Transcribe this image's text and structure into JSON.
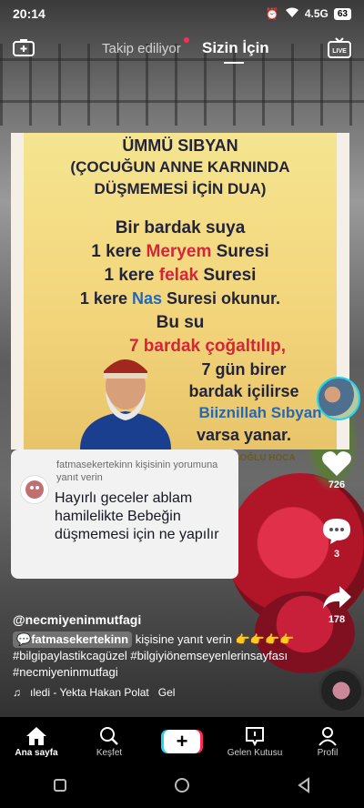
{
  "status_bar": {
    "time": "20:14",
    "network": "4.5G",
    "battery": "63"
  },
  "top_nav": {
    "following_label": "Takip ediliyor",
    "for_you_label": "Sizin İçin",
    "live_label": "LIVE"
  },
  "poster": {
    "title_line1": "ÜMMÜ SIBYAN",
    "title_line2": "(ÇOCUĞUN ANNE KARNINDA",
    "title_line3": "DÜŞMEMESİ İÇİN DUA)",
    "l1": "Bir bardak suya",
    "l2a": "1 kere ",
    "l2b": "Meryem",
    "l2c": " Suresi",
    "l3a": "1 kere ",
    "l3b": "felak",
    "l3c": " Suresi",
    "l4a": "1 kere ",
    "l4b": "Nas",
    "l4c": " Suresi okunur.",
    "l5": "Bu su",
    "l6": "7 bardak çoğaltılıp,",
    "l7": "7 gün birer",
    "l8": "bardak içilirse",
    "l9": "Biiznillah Sıbyan",
    "l10": "varsa yanar.",
    "signature": "TİŞOĞLU HOCA"
  },
  "comment_card": {
    "header": "fatmasekertekinn kişisinin yorumuna yanıt verin",
    "text": "Hayırlı geceler ablam hamilelikte Bebeğin düşmemesi için ne yapılır"
  },
  "actions": {
    "likes": "726",
    "comments": "3",
    "shares": "178"
  },
  "caption": {
    "username": "@necmiyeninmutfagi",
    "mention": "fatmasekertekinn",
    "reply_text": " kişisine yanıt verin 👉👉👉👉",
    "hashtags_line1": "#bilgipaylastikcagüzel #bilgiyiönemseyenlerinsayfası",
    "hashtags_line2": "#necmiyeninmutfagi"
  },
  "music": {
    "track": "ıledi - Yekta Hakan Polat",
    "extra": "Gel"
  },
  "bottom_nav": {
    "home": "Ana sayfa",
    "discover": "Keşfet",
    "create": "+",
    "inbox": "Gelen Kutusu",
    "profile": "Profil"
  }
}
